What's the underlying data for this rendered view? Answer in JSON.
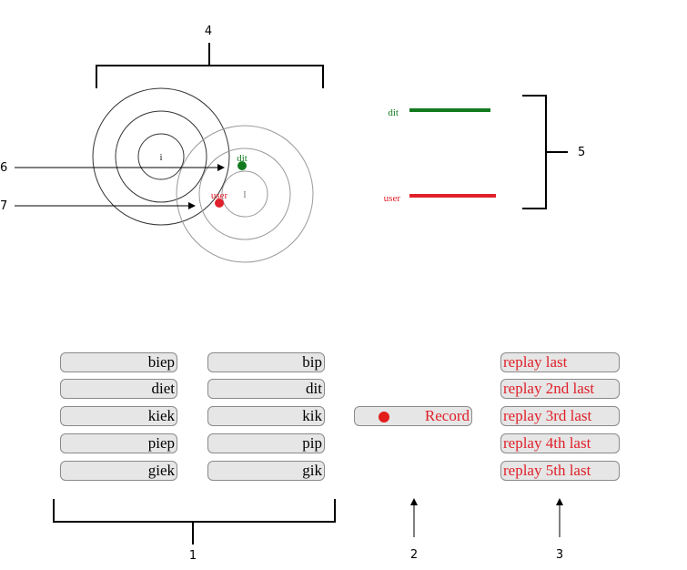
{
  "callouts": {
    "n1": "1",
    "n2": "2",
    "n3": "3",
    "n4": "4",
    "n5": "5",
    "n6": "6",
    "n7": "7"
  },
  "circle_labels": {
    "target_letter": "i",
    "other_letter": "I"
  },
  "markers": {
    "dit": "dit",
    "user": "user"
  },
  "legend": {
    "dit": "dit",
    "user": "user"
  },
  "word_buttons": {
    "left": [
      "biep",
      "diet",
      "kiek",
      "piep",
      "giek"
    ],
    "right": [
      "bip",
      "dit",
      "kik",
      "pip",
      "gik"
    ]
  },
  "record_button": {
    "label": "Record"
  },
  "replay_buttons": [
    "replay last",
    "replay 2nd last",
    "replay 3rd last",
    "replay 4th last",
    "replay 5th last"
  ],
  "colors": {
    "dit": "#127a1e",
    "user": "#e0202a",
    "record_dot": "#e21b1b"
  }
}
